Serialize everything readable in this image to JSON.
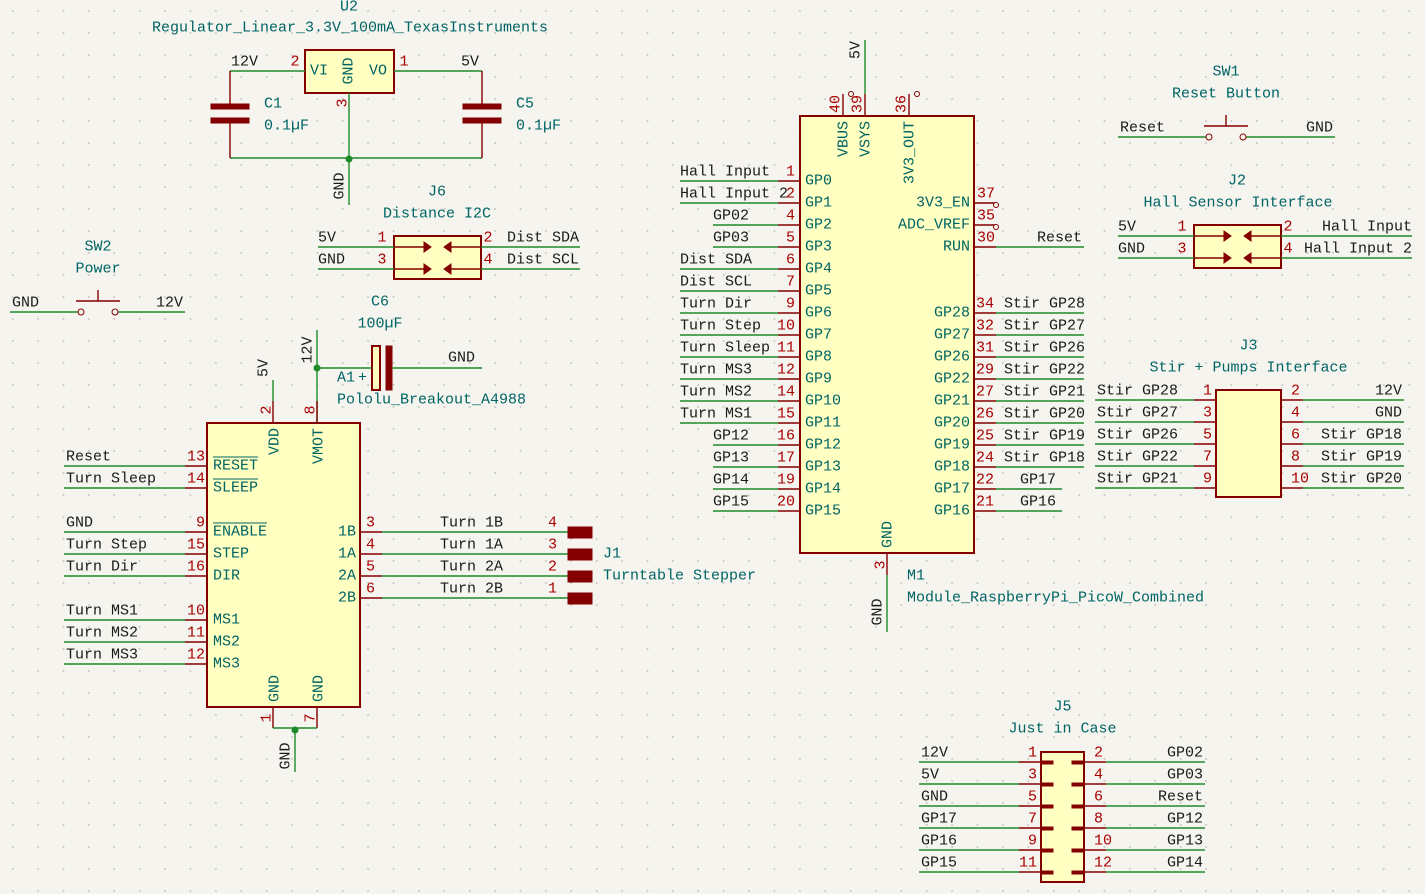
{
  "colors": {
    "wire": "#1f8a2a",
    "component_outline": "#840000",
    "component_fill": "#ffffc2",
    "reference_text": "#006464",
    "pin_number": "#a90000",
    "background": "#f5f4ef"
  },
  "u2": {
    "ref": "U2",
    "value": "Regulator_Linear_3.3V_100mA_TexasInstruments",
    "pin_vi": "VI",
    "pin_gnd": "GND",
    "pin_vo": "VO",
    "num_vi": "2",
    "num_gnd": "3",
    "num_vo": "1",
    "net_in": "12V",
    "net_out": "5V",
    "net_gnd": "GND"
  },
  "c1": {
    "ref": "C1",
    "value": "0.1µF"
  },
  "c5": {
    "ref": "C5",
    "value": "0.1µF"
  },
  "j6": {
    "ref": "J6",
    "value": "Distance I2C",
    "left": [
      {
        "num": "1",
        "net": "5V"
      },
      {
        "num": "3",
        "net": "GND"
      }
    ],
    "right": [
      {
        "num": "2",
        "net": "Dist SDA"
      },
      {
        "num": "4",
        "net": "Dist SCL"
      }
    ]
  },
  "sw2": {
    "ref": "SW2",
    "value": "Power",
    "left_net": "GND",
    "right_net": "12V"
  },
  "c6": {
    "ref": "C6",
    "value": "100µF",
    "net_left": "12V",
    "net_right": "GND",
    "polarity": "+"
  },
  "a1": {
    "ref": "A1",
    "value": "Pololu_Breakout_A4988",
    "left": [
      {
        "name": "RESET",
        "num": "13",
        "net": "Reset",
        "active_low": true
      },
      {
        "name": "SLEEP",
        "num": "14",
        "net": "Turn Sleep",
        "active_low": true
      },
      {
        "name": "ENABLE",
        "num": "9",
        "net": "GND",
        "active_low": true
      },
      {
        "name": "STEP",
        "num": "15",
        "net": "Turn Step"
      },
      {
        "name": "DIR",
        "num": "16",
        "net": "Turn Dir"
      },
      {
        "name": "MS1",
        "num": "10",
        "net": "Turn MS1"
      },
      {
        "name": "MS2",
        "num": "11",
        "net": "Turn MS2"
      },
      {
        "name": "MS3",
        "num": "12",
        "net": "Turn MS3"
      }
    ],
    "top": [
      {
        "name": "VDD",
        "num": "2",
        "net": "5V"
      },
      {
        "name": "VMOT",
        "num": "8",
        "net": "12V"
      }
    ],
    "right": [
      {
        "name": "1B",
        "num": "3",
        "net": "Turn 1B",
        "jnum": "4"
      },
      {
        "name": "1A",
        "num": "4",
        "net": "Turn 1A",
        "jnum": "3"
      },
      {
        "name": "2A",
        "num": "5",
        "net": "Turn 2A",
        "jnum": "2"
      },
      {
        "name": "2B",
        "num": "6",
        "net": "Turn 2B",
        "jnum": "1"
      }
    ],
    "bottom": [
      {
        "name": "GND",
        "num": "1"
      },
      {
        "name": "GND",
        "num": "7"
      }
    ],
    "gnd_net": "GND"
  },
  "j1": {
    "ref": "J1",
    "value": "Turntable Stepper"
  },
  "m1": {
    "ref": "M1",
    "value": "Module_RaspberryPi_PicoW_Combined",
    "top": [
      {
        "name": "VBUS",
        "num": "40"
      },
      {
        "name": "VSYS",
        "num": "39"
      },
      {
        "name": "3V3_OUT",
        "num": "36"
      }
    ],
    "top_net": "5V",
    "left": [
      {
        "name": "GP0",
        "num": "1",
        "net": "Hall Input"
      },
      {
        "name": "GP1",
        "num": "2",
        "net": "Hall Input 2"
      },
      {
        "name": "GP2",
        "num": "4",
        "net": "GP02"
      },
      {
        "name": "GP3",
        "num": "5",
        "net": "GP03"
      },
      {
        "name": "GP4",
        "num": "6",
        "net": "Dist SDA"
      },
      {
        "name": "GP5",
        "num": "7",
        "net": "Dist SCL"
      },
      {
        "name": "GP6",
        "num": "9",
        "net": "Turn Dir"
      },
      {
        "name": "GP7",
        "num": "10",
        "net": "Turn Step"
      },
      {
        "name": "GP8",
        "num": "11",
        "net": "Turn Sleep"
      },
      {
        "name": "GP9",
        "num": "12",
        "net": "Turn MS3"
      },
      {
        "name": "GP10",
        "num": "14",
        "net": "Turn MS2"
      },
      {
        "name": "GP11",
        "num": "15",
        "net": "Turn MS1"
      },
      {
        "name": "GP12",
        "num": "16",
        "net": "GP12"
      },
      {
        "name": "GP13",
        "num": "17",
        "net": "GP13"
      },
      {
        "name": "GP14",
        "num": "19",
        "net": "GP14"
      },
      {
        "name": "GP15",
        "num": "20",
        "net": "GP15"
      }
    ],
    "right_top": [
      {
        "name": "3V3_EN",
        "num": "37",
        "net": ""
      },
      {
        "name": "ADC_VREF",
        "num": "35",
        "net": ""
      },
      {
        "name": "RUN",
        "num": "30",
        "net": "Reset"
      }
    ],
    "right": [
      {
        "name": "GP28",
        "num": "34",
        "net": "Stir GP28"
      },
      {
        "name": "GP27",
        "num": "32",
        "net": "Stir GP27"
      },
      {
        "name": "GP26",
        "num": "31",
        "net": "Stir GP26"
      },
      {
        "name": "GP22",
        "num": "29",
        "net": "Stir GP22"
      },
      {
        "name": "GP21",
        "num": "27",
        "net": "Stir GP21"
      },
      {
        "name": "GP20",
        "num": "26",
        "net": "Stir GP20"
      },
      {
        "name": "GP19",
        "num": "25",
        "net": "Stir GP19"
      },
      {
        "name": "GP18",
        "num": "24",
        "net": "Stir GP18"
      },
      {
        "name": "GP17",
        "num": "22",
        "net": "GP17"
      },
      {
        "name": "GP16",
        "num": "21",
        "net": "GP16"
      }
    ],
    "bottom": {
      "name": "GND",
      "num": "3",
      "net": "GND"
    }
  },
  "sw1": {
    "ref": "SW1",
    "value": "Reset Button",
    "left_net": "Reset",
    "right_net": "GND"
  },
  "j2": {
    "ref": "J2",
    "value": "Hall Sensor Interface",
    "left": [
      {
        "num": "1",
        "net": "5V"
      },
      {
        "num": "3",
        "net": "GND"
      }
    ],
    "right": [
      {
        "num": "2",
        "net": "Hall Input"
      },
      {
        "num": "4",
        "net": "Hall Input 2"
      }
    ]
  },
  "j3": {
    "ref": "J3",
    "value": "Stir + Pumps Interface",
    "left": [
      {
        "num": "1",
        "net": "Stir GP28"
      },
      {
        "num": "3",
        "net": "Stir GP27"
      },
      {
        "num": "5",
        "net": "Stir GP26"
      },
      {
        "num": "7",
        "net": "Stir GP22"
      },
      {
        "num": "9",
        "net": "Stir GP21"
      }
    ],
    "right": [
      {
        "num": "2",
        "net": "12V"
      },
      {
        "num": "4",
        "net": "GND"
      },
      {
        "num": "6",
        "net": "Stir GP18"
      },
      {
        "num": "8",
        "net": "Stir GP19"
      },
      {
        "num": "10",
        "net": "Stir GP20"
      }
    ]
  },
  "j5": {
    "ref": "J5",
    "value": "Just in Case",
    "left": [
      {
        "num": "1",
        "net": "12V"
      },
      {
        "num": "3",
        "net": "5V"
      },
      {
        "num": "5",
        "net": "GND"
      },
      {
        "num": "7",
        "net": "GP17"
      },
      {
        "num": "9",
        "net": "GP16"
      },
      {
        "num": "11",
        "net": "GP15"
      }
    ],
    "right": [
      {
        "num": "2",
        "net": "GP02"
      },
      {
        "num": "4",
        "net": "GP03"
      },
      {
        "num": "6",
        "net": "Reset"
      },
      {
        "num": "8",
        "net": "GP12"
      },
      {
        "num": "10",
        "net": "GP13"
      },
      {
        "num": "12",
        "net": "GP14"
      }
    ]
  }
}
